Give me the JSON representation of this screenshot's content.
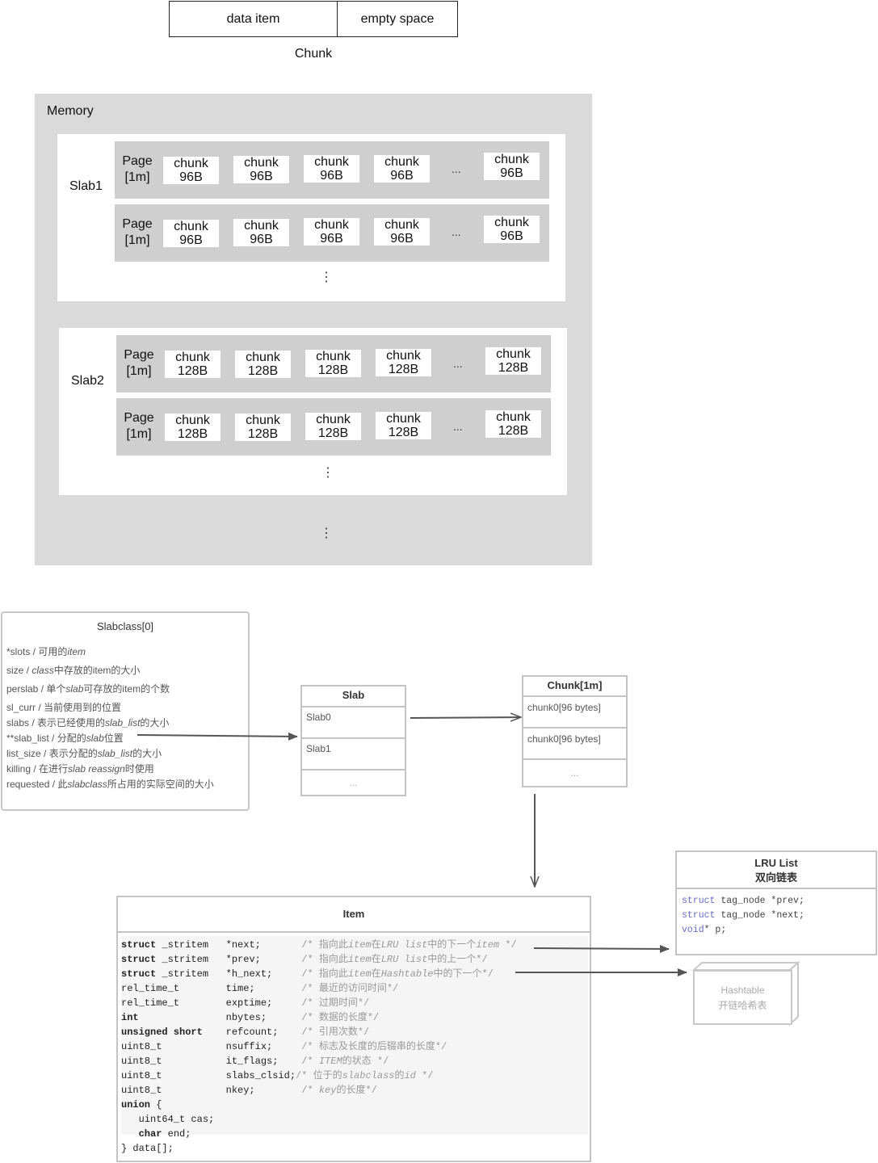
{
  "chunk_diagram": {
    "data_item": "data item",
    "empty_space": "empty space",
    "caption": "Chunk"
  },
  "memory": {
    "title": "Memory",
    "slabs": [
      {
        "label": "Slab1",
        "pages": [
          {
            "label_line1": "Page",
            "label_line2": "[1m]",
            "chunks": [
              "chunk",
              "chunk",
              "chunk",
              "chunk",
              "chunk"
            ],
            "chunk_size": "96B",
            "ellipsis": "..."
          },
          {
            "label_line1": "Page",
            "label_line2": "[1m]",
            "chunks": [
              "chunk",
              "chunk",
              "chunk",
              "chunk",
              "chunk"
            ],
            "chunk_size": "96B",
            "ellipsis": "..."
          }
        ],
        "more": "⋮"
      },
      {
        "label": "Slab2",
        "pages": [
          {
            "label_line1": "Page",
            "label_line2": "[1m]",
            "chunks": [
              "chunk",
              "chunk",
              "chunk",
              "chunk",
              "chunk"
            ],
            "chunk_size": "128B",
            "ellipsis": "..."
          },
          {
            "label_line1": "Page",
            "label_line2": "[1m]",
            "chunks": [
              "chunk",
              "chunk",
              "chunk",
              "chunk",
              "chunk"
            ],
            "chunk_size": "128B",
            "ellipsis": "..."
          }
        ],
        "more": "⋮"
      }
    ],
    "more": "⋮"
  },
  "slabclass": {
    "title": "Slabclass[0]",
    "fields": [
      {
        "name": "*slots",
        "sep": " / ",
        "desc": "可用的",
        "em": "item",
        "tail": ""
      },
      {
        "name": "size",
        "sep": " / ",
        "desc": "",
        "em": "class",
        "tail": "中存放的item的大小"
      },
      {
        "name": "perslab",
        "sep": " / ",
        "desc": "单个",
        "em": "slab",
        "tail": "可存放的item的个数"
      },
      {
        "name": "sl_curr",
        "sep": " / ",
        "desc": "当前使用到的位置",
        "em": "",
        "tail": ""
      },
      {
        "name": "slabs",
        "sep": " / ",
        "desc": "表示已经使用的",
        "em": "slab_list",
        "tail": "的大小"
      },
      {
        "name": "**slab_list",
        "sep": " / ",
        "desc": "分配的",
        "em": "slab",
        "tail": "位置"
      },
      {
        "name": "list_size",
        "sep": " / ",
        "desc": "表示分配的",
        "em": "slab_list",
        "tail": "的大小"
      },
      {
        "name": "killing",
        "sep": " / ",
        "desc": "在进行",
        "em": "slab reassign",
        "tail": "时使用"
      },
      {
        "name": "requested",
        "sep": " / ",
        "desc": "此",
        "em": "slabclass",
        "tail": "所占用的实际空间的大小"
      }
    ]
  },
  "slab_table": {
    "title": "Slab",
    "rows": [
      "Slab0",
      "Slab1",
      "..."
    ]
  },
  "chunk_table": {
    "title": "Chunk[1m]",
    "rows": [
      "chunk0[96 bytes]",
      "chunk0[96 bytes]",
      "..."
    ]
  },
  "lru_list": {
    "title": "LRU List",
    "subtitle": "双向链表",
    "code": [
      {
        "kw": "struct",
        "rest": " tag_node *prev;"
      },
      {
        "kw": "struct",
        "rest": " tag_node *next;"
      },
      {
        "kw": "void",
        "rest": "* p;"
      }
    ]
  },
  "hashtable": {
    "title": "Hashtable",
    "subtitle": "开链哈希表"
  },
  "item": {
    "title": "Item",
    "fields": [
      {
        "type_bold": "struct",
        "type_rest": " _stritem",
        "name": "*next;",
        "comment": "/* 指向此item在LRU list中的下一个item */"
      },
      {
        "type_bold": "struct",
        "type_rest": " _stritem",
        "name": "*prev;",
        "comment": "/* 指向此item在LRU list中的上一个*/"
      },
      {
        "type_bold": "struct",
        "type_rest": " _stritem",
        "name": "*h_next;",
        "comment": "/* 指向此item在Hashtable中的下一个*/"
      },
      {
        "type_bold": "",
        "type_rest": "rel_time_t",
        "name": "time;",
        "comment": "/* 最近的访问时间*/"
      },
      {
        "type_bold": "",
        "type_rest": "rel_time_t",
        "name": "exptime;",
        "comment": "/* 过期时间*/"
      },
      {
        "type_bold": "int",
        "type_rest": "",
        "name": "nbytes;",
        "comment": "/* 数据的长度*/"
      },
      {
        "type_bold": "unsigned short",
        "type_rest": "",
        "name": "refcount;",
        "comment": "/* 引用次数*/"
      },
      {
        "type_bold": "",
        "type_rest": "uint8_t",
        "name": "nsuffix;",
        "comment": "/* 标志及长度的后辍串的长度*/"
      },
      {
        "type_bold": "",
        "type_rest": "uint8_t",
        "name": "it_flags;",
        "comment": "/* ITEM的状态 */"
      },
      {
        "type_bold": "",
        "type_rest": "uint8_t",
        "name": "slabs_clsid;",
        "comment": "/* 位于的slabclass的id */"
      },
      {
        "type_bold": "",
        "type_rest": "uint8_t",
        "name": "nkey;",
        "comment": "/* key的长度*/"
      }
    ],
    "union_open": "union {",
    "union_members": [
      {
        "type_bold": "",
        "text": "uint64_t cas;"
      },
      {
        "type_bold": "char",
        "text": " end;"
      }
    ],
    "union_close": "} data[];"
  }
}
